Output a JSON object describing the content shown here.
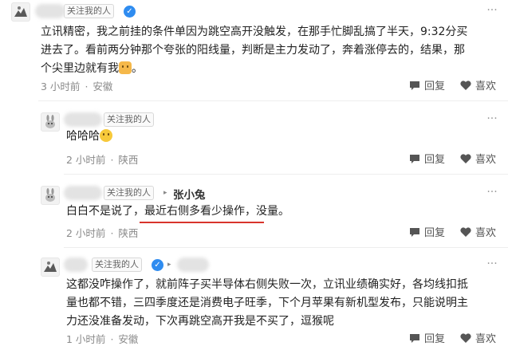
{
  "comments": [
    {
      "follow_tag": "关注我的人",
      "text_line1": "立讯精密，我之前挂的条件单因为跳空高开没触发，在那手忙脚乱搞了半天，9:32分买",
      "text_line2": "进去了。看前两分钟那个夸张的阳线量，判断是主力发动了，奔着涨停去的，结果，那",
      "text_line3": "个尖里边就有我",
      "time": "3 小时前",
      "location": "安徽",
      "reply": "回复",
      "like": "喜欢"
    },
    {
      "follow_tag": "关注我的人",
      "text": "哈哈哈",
      "time": "2 小时前",
      "location": "陕西",
      "reply": "回复",
      "like": "喜欢"
    },
    {
      "follow_tag": "关注我的人",
      "reply_to": "张小兔",
      "text_before": "白白不是说了，",
      "text_highlight": "最近右侧多看少操作",
      "text_after": "，没量。",
      "time": "2 小时前",
      "location": "陕西",
      "reply": "回复",
      "like": "喜欢"
    },
    {
      "follow_tag": "关注我的人",
      "text_line1": "这都没咋操作了，就前阵子买半导体右侧失败一次，立讯业绩确实好，各均线扣抵",
      "text_line2": "量也都不错，三四季度还是消费电子旺季，下个月苹果有新机型发布，只能说明主",
      "text_line3": "力还没准备发动，下次再跳空高开我是不买了，逗猴呢",
      "time": "1 小时前",
      "location": "安徽",
      "reply": "回复",
      "like": "喜欢"
    }
  ],
  "colors": {
    "highlight_underline": "#d8342c",
    "verified": "#2f8cf0",
    "meta_text": "#8a8a8a"
  }
}
